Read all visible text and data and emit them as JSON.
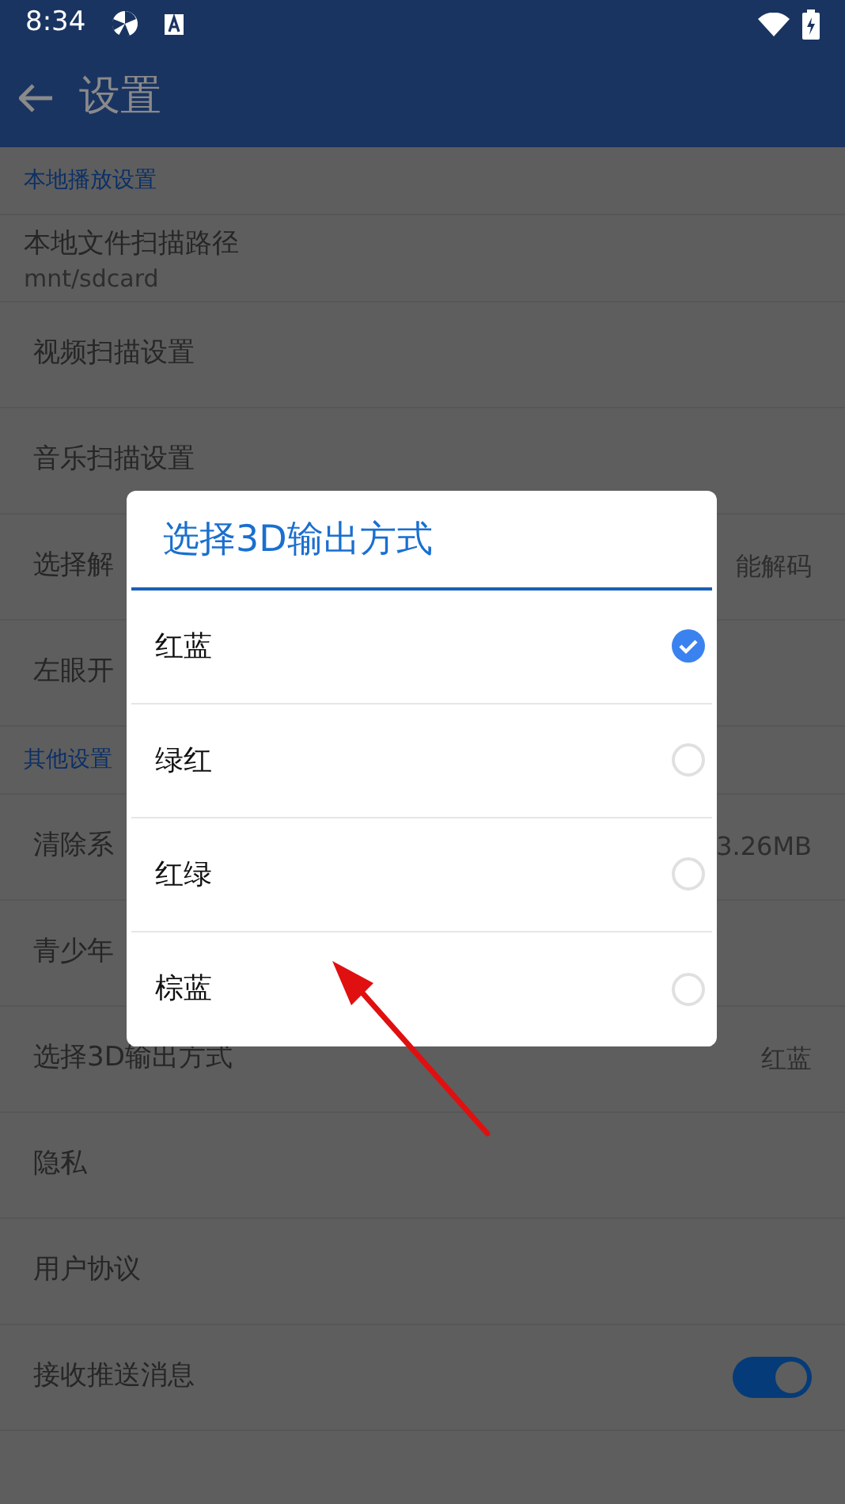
{
  "status_bar": {
    "time": "8:34"
  },
  "app_bar": {
    "title": "设置"
  },
  "sections": [
    {
      "header": "本地播放设置",
      "rows": [
        {
          "kind": "subtitle",
          "label": "本地文件扫描路径",
          "subtitle": "mnt/sdcard"
        },
        {
          "kind": "text",
          "label": "视频扫描设置"
        },
        {
          "kind": "text",
          "label": "音乐扫描设置"
        },
        {
          "kind": "text",
          "label": "选择解",
          "value": "能解码"
        },
        {
          "kind": "text",
          "label": "左眼开"
        }
      ]
    },
    {
      "header": "其他设置",
      "rows": [
        {
          "kind": "text",
          "label": "清除系",
          "value": "3.26MB"
        },
        {
          "kind": "text",
          "label": "青少年"
        },
        {
          "kind": "text",
          "label": "选择3D输出方式",
          "value": "红蓝"
        },
        {
          "kind": "text",
          "label": "隐私"
        },
        {
          "kind": "text",
          "label": "用户协议"
        },
        {
          "kind": "toggle",
          "label": "接收推送消息",
          "on": true
        }
      ]
    }
  ],
  "dialog": {
    "title": "选择3D输出方式",
    "options": [
      {
        "label": "红蓝",
        "selected": true
      },
      {
        "label": "绿红",
        "selected": false
      },
      {
        "label": "红绿",
        "selected": false
      },
      {
        "label": "棕蓝",
        "selected": false
      }
    ]
  }
}
